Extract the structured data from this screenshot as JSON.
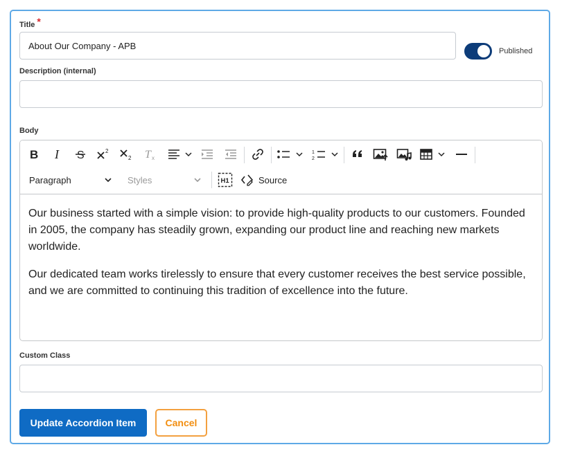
{
  "form": {
    "title_label": "Title",
    "required_marker": "*",
    "title_value": "About Our Company - APB",
    "published_label": "Published",
    "published_on": true,
    "description_label": "Description (internal)",
    "description_value": "",
    "body_label": "Body",
    "custom_class_label": "Custom Class",
    "custom_class_value": ""
  },
  "editor": {
    "toolbar_icons": [
      "bold-icon",
      "italic-icon",
      "strikethrough-icon",
      "superscript-icon",
      "subscript-icon",
      "remove-format-icon",
      "align-icon",
      "outdent-icon",
      "indent-icon",
      "link-icon",
      "bulleted-list-icon",
      "numbered-list-icon",
      "blockquote-icon",
      "insert-image-icon",
      "insert-media-icon",
      "table-icon",
      "horizontal-line-icon",
      "heading-h1-icon",
      "source-icon"
    ],
    "heading_select": "Paragraph",
    "styles_select": "Styles",
    "source_label": "Source",
    "h1_label": "H1",
    "paragraphs": [
      "Our business started with a simple vision: to provide high-quality products to our customers. Founded in 2005, the company has steadily grown, expanding our product line and reaching new markets worldwide.",
      "Our dedicated team works tirelessly to ensure that every customer receives the best service possible, and we are committed to continuing this tradition of excellence into the future."
    ]
  },
  "actions": {
    "submit_label": "Update Accordion Item",
    "cancel_label": "Cancel"
  },
  "colors": {
    "frame_border": "#5ea9e6",
    "toggle_on": "#0d3c79",
    "primary_button": "#0f6bc4",
    "cancel_accent": "#f28e10",
    "required": "#d6262b"
  }
}
